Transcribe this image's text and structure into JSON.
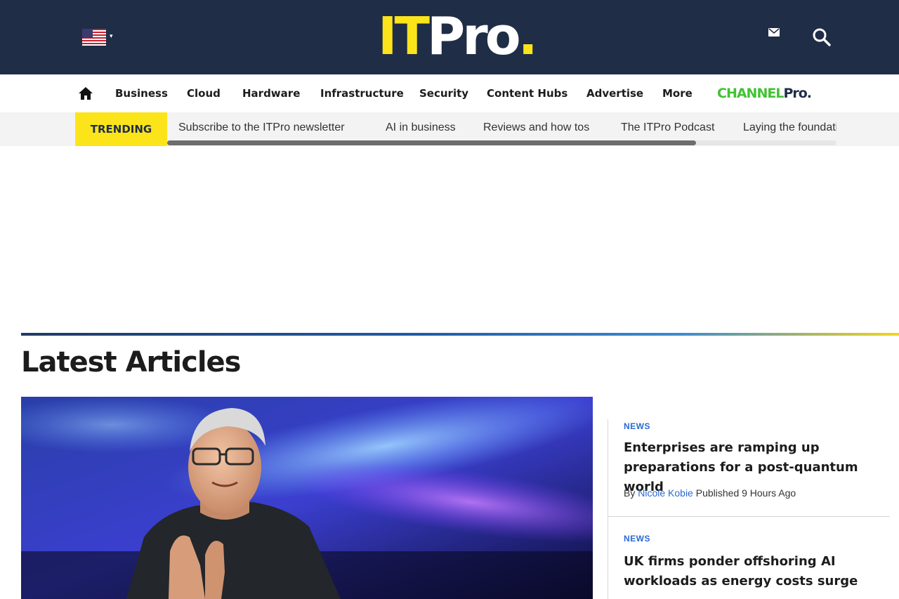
{
  "header": {
    "region_flag": "us-flag-icon",
    "logo": {
      "it": "IT",
      "pro": "Pro",
      "dot": "."
    },
    "icons": [
      "mail-icon",
      "search-icon"
    ],
    "brand_colors": {
      "navy": "#1f2d47",
      "yellow": "#fce41a",
      "green": "#42c234"
    }
  },
  "nav": {
    "home_icon": "home-icon",
    "items": [
      "Business",
      "Cloud",
      "Hardware",
      "Infrastructure",
      "Security",
      "Content Hubs",
      "Advertise",
      "More"
    ],
    "partner": {
      "channel": "CHANNEL",
      "pro": "Pro."
    }
  },
  "trending": {
    "label": "TRENDING",
    "items": [
      "Subscribe to the ITPro newsletter",
      "AI in business",
      "Reviews and how tos",
      "The ITPro Podcast",
      "Laying the foundations for AI"
    ],
    "scroll_fraction": 0.79
  },
  "latest": {
    "title": "Latest Articles",
    "articles": [
      {
        "tag": "NEWS",
        "headline": "Enterprises are ramping up preparations for a post-quantum world",
        "by": "By",
        "author": "Nicole Kobie",
        "published": "Published 9 Hours Ago"
      },
      {
        "tag": "NEWS",
        "headline": "UK firms ponder offshoring AI workloads as energy costs surge"
      }
    ]
  }
}
